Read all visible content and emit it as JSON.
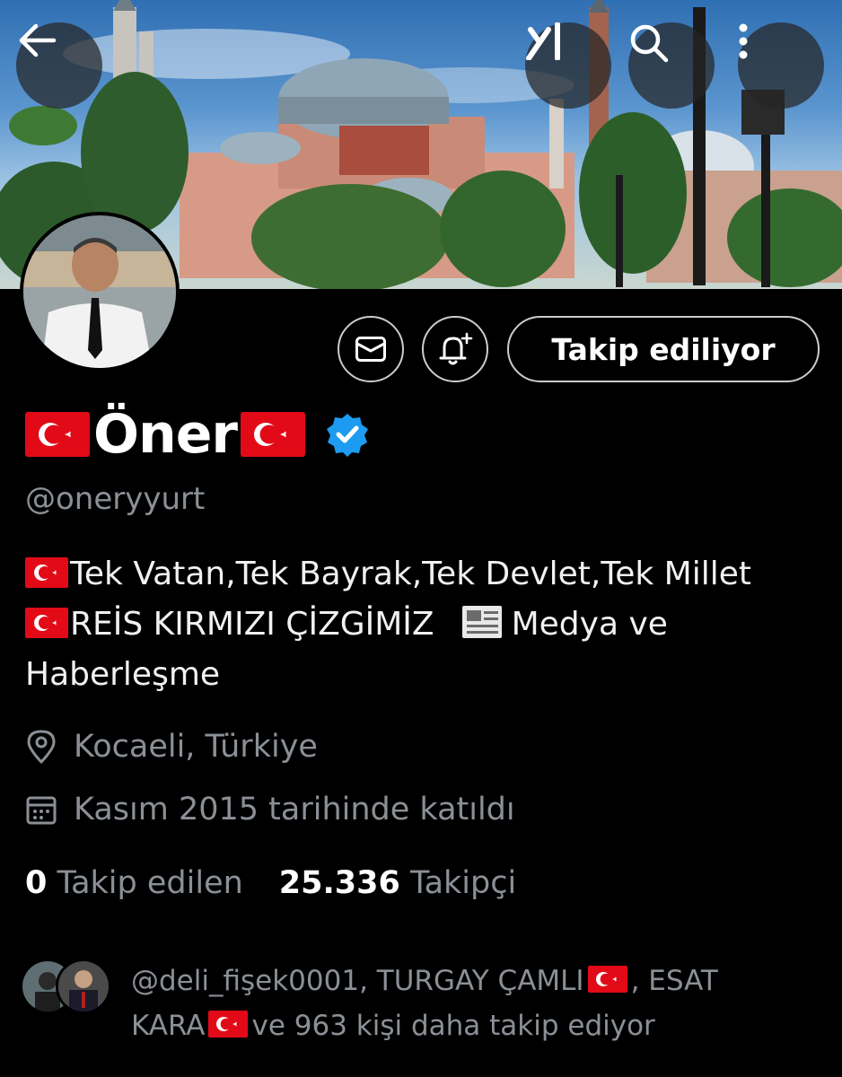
{
  "header": {
    "back_icon": "arrow-left-icon",
    "grok_icon": "grok-icon",
    "search_icon": "search-icon",
    "more_icon": "more-vertical-icon"
  },
  "banner": {
    "description_icon": "banner-image"
  },
  "actions": {
    "message_icon": "mail-icon",
    "notify_icon": "bell-plus-icon",
    "follow_label": "Takip ediliyor"
  },
  "profile": {
    "name": "Öner",
    "handle": "@oneryyurt",
    "bio_line1": "Tek Vatan,Tek Bayrak,Tek Devlet,Tek Millet",
    "bio_line2a": "REİS KIRMIZI ÇİZGİMİZ",
    "bio_line2b": "Medya ve",
    "bio_line3": "Haberleşme",
    "location": "Kocaeli, Türkiye",
    "joined": "Kasım 2015 tarihinde katıldı"
  },
  "stats": {
    "following_count": "0",
    "following_label": "Takip edilen",
    "followers_count": "25.336",
    "followers_label": "Takipçi"
  },
  "followed_by": {
    "part1": "@deli_fişek0001, TURGAY ÇAMLI",
    "part2": ", ESAT",
    "part3": "KARA",
    "part4": "ve 963 kişi daha takip ediyor"
  },
  "colors": {
    "background": "#000000",
    "verified": "#1d9bf0",
    "flag_red": "#e30a17",
    "muted_text": "#8b9096"
  }
}
